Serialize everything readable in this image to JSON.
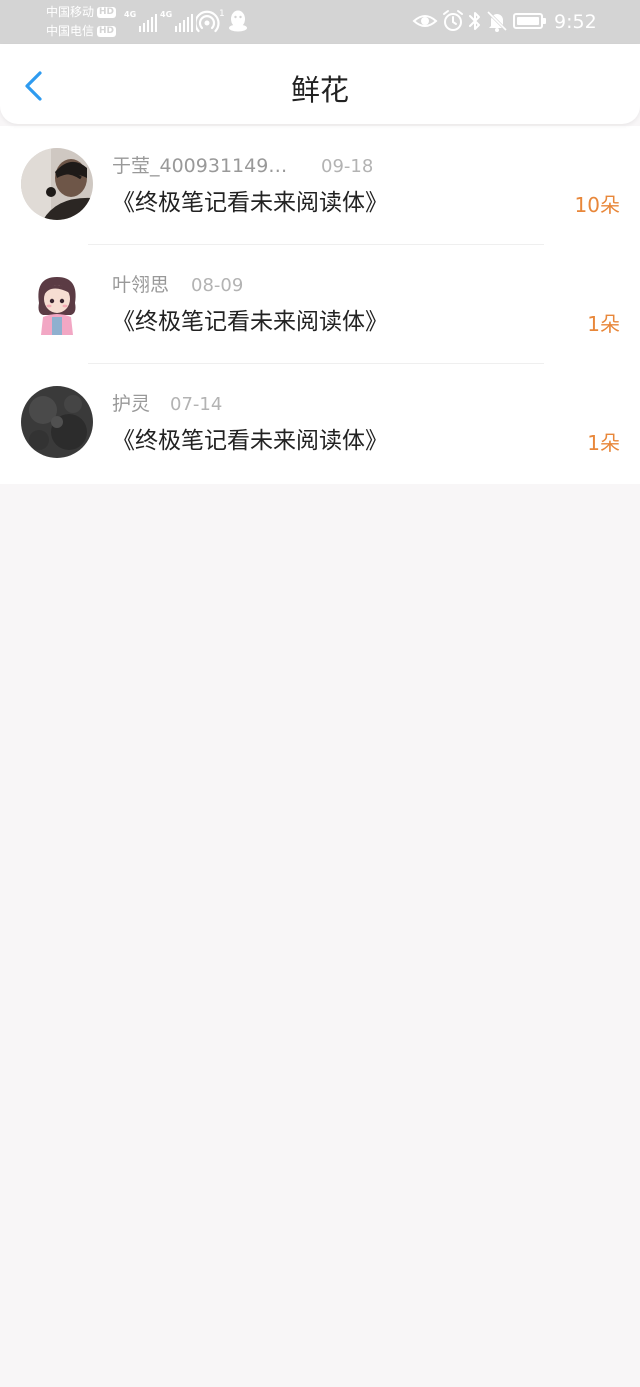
{
  "status_bar": {
    "carrier_1": "中国移动",
    "carrier_2": "中国电信",
    "hd": "HD",
    "network_1": "4G",
    "network_2": "4G",
    "hotspot_count": "1",
    "time": "9:52"
  },
  "header": {
    "title": "鲜花"
  },
  "flowers": [
    {
      "name": "于莹_400931149…",
      "date": "09-18",
      "book": "《终极笔记看未来阅读体》",
      "count": "10朵"
    },
    {
      "name": "叶翎思",
      "date": "08-09",
      "book": "《终极笔记看未来阅读体》",
      "count": "1朵"
    },
    {
      "name": "护灵",
      "date": "07-14",
      "book": "《终极笔记看未来阅读体》",
      "count": "1朵"
    }
  ],
  "colors": {
    "accent_back": "#2e9bf0",
    "count": "#e8873a",
    "status_bar": "#d4d4d4",
    "page_bg": "#f8f6f7"
  }
}
